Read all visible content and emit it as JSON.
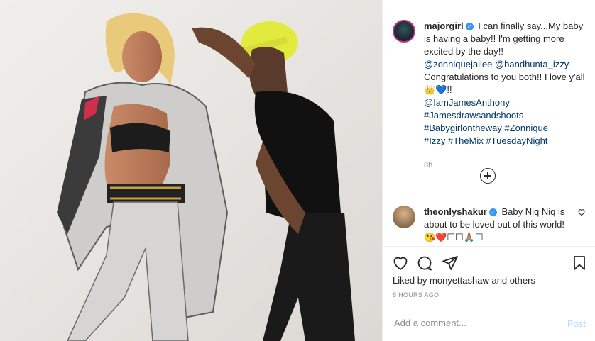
{
  "post": {
    "author": {
      "username": "majorgirl",
      "verified": true,
      "caption_text": "I can finally say...My baby is having a baby!! I'm getting more excited by the day!!",
      "mentions": [
        "@zonniquejailee",
        "@bandhunta_izzy"
      ],
      "caption_text_2": "Congratulations to you both!! I love y'all",
      "caption_emojis": "👑💙!!",
      "tags": [
        "@IamJamesAnthony",
        "#Jamesdrawsandshoots",
        "#Babygirlontheway",
        "#Zonnique",
        "#Izzy",
        "#TheMix",
        "#TuesdayNight"
      ],
      "time": "8h"
    },
    "comments": [
      {
        "username": "theonlyshakur",
        "verified": true,
        "text": "Baby Niq Niq is about to be loved out of this world! 😘❤️☐☐🙏🏽☐"
      }
    ],
    "liked_by": "Liked by monyettashaw and others",
    "posted_ago": "8 HOURS AGO",
    "add_comment_placeholder": "Add a comment...",
    "post_label": "Post",
    "icons": {
      "like": "heart-icon",
      "comment": "comment-icon",
      "share": "share-icon",
      "save": "bookmark-icon",
      "load_more": "plus-circle-icon"
    }
  }
}
